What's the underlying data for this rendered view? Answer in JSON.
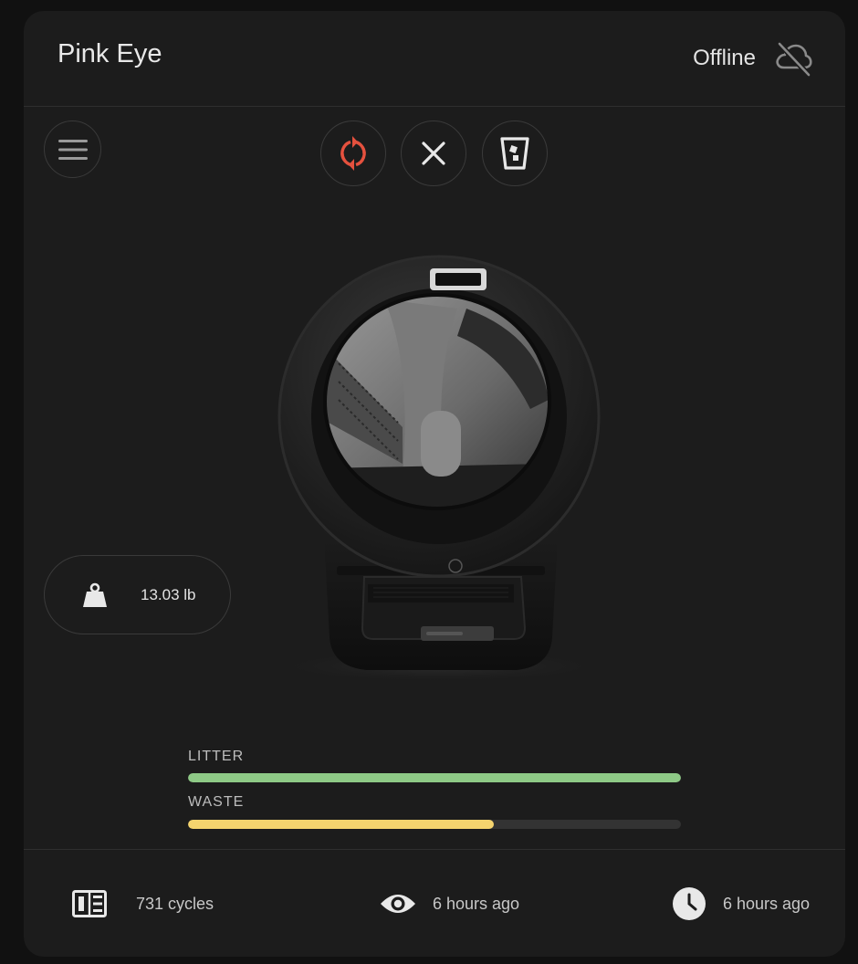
{
  "header": {
    "title": "Pink Eye",
    "status": "Offline",
    "status_icon": "cloud-off-icon"
  },
  "controls": {
    "menu_icon": "menu-icon",
    "cycle_icon": "refresh-icon",
    "reset_icon": "close-icon",
    "empty_icon": "empty-bin-icon",
    "cycle_color": "#e5513e"
  },
  "weight": {
    "icon": "weight-icon",
    "value": "13.03 lb"
  },
  "levels": {
    "litter": {
      "label": "LITTER",
      "level": 1.0,
      "color": "#8ec986"
    },
    "waste": {
      "label": "WASTE",
      "level": 0.62,
      "color": "#f5d46e"
    }
  },
  "footer": {
    "cycles": {
      "icon": "counter-icon",
      "text": "731 cycles"
    },
    "last_seen": {
      "icon": "eye-icon",
      "text": "6 hours ago"
    },
    "last_cycle": {
      "icon": "clock-icon",
      "text": "6 hours ago"
    }
  }
}
